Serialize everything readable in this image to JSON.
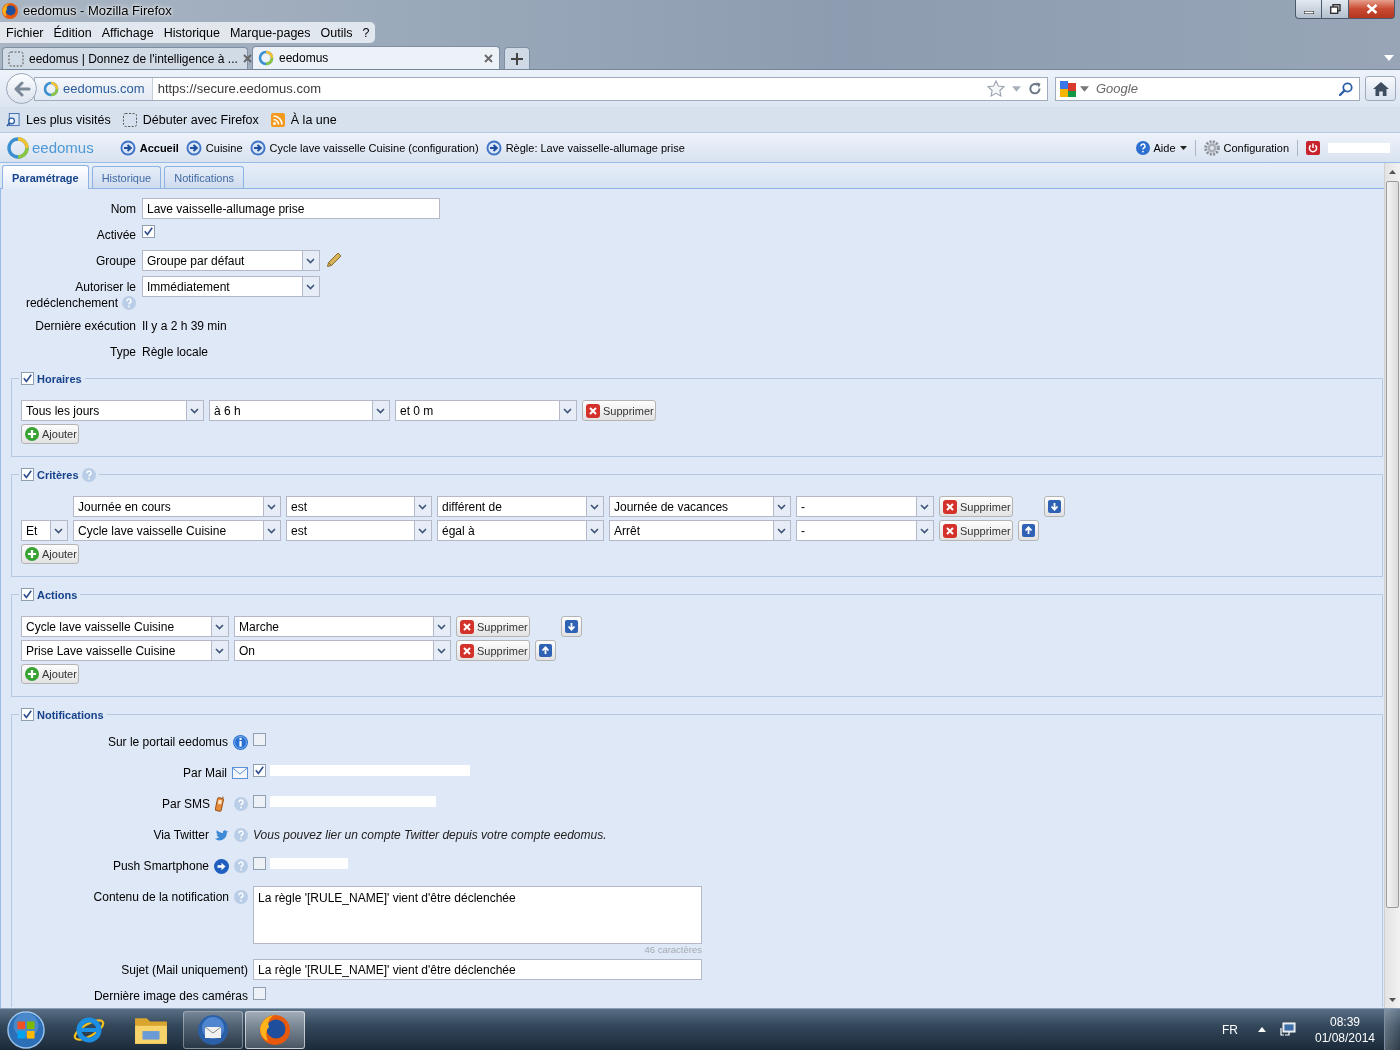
{
  "window": {
    "title": "eedomus - Mozilla Firefox"
  },
  "menu_bar": [
    "Fichier",
    "Édition",
    "Affichage",
    "Historique",
    "Marque-pages",
    "Outils",
    "?"
  ],
  "browser_tabs": [
    {
      "label": "eedomus | Donnez de l'intelligence à ...",
      "selected": false
    },
    {
      "label": "eedomus",
      "selected": true
    }
  ],
  "address_bar": {
    "site": "eedomus.com",
    "url": "https://secure.eedomus.com"
  },
  "search_bar": {
    "placeholder": "Google"
  },
  "bookmarks": [
    "Les plus visités",
    "Débuter avec Firefox",
    "À la une"
  ],
  "app_header": {
    "logo": "eedomus",
    "breadcrumb": [
      "Accueil",
      "Cuisine",
      "Cycle lave vaisselle Cuisine (configuration)",
      "Règle: Lave vaisselle-allumage prise"
    ],
    "help": "Aide",
    "settings": "Configuration"
  },
  "page_tabs": [
    {
      "label": "Paramétrage",
      "selected": true
    },
    {
      "label": "Historique",
      "selected": false
    },
    {
      "label": "Notifications",
      "selected": false
    }
  ],
  "form": [
    {
      "label": "Nom",
      "kind": "text",
      "value": "Lave vaisselle-allumage prise"
    },
    {
      "label": "Activée",
      "kind": "checkbox",
      "checked": true
    },
    {
      "label": "Groupe",
      "kind": "select",
      "value": "Groupe par défaut",
      "editable": true
    },
    {
      "label": "Autoriser le redéclenchement",
      "kind": "select",
      "value": "Immédiatement",
      "help": true
    },
    {
      "label": "Dernière exécution",
      "kind": "info",
      "value": "Il y a 2 h 39 min"
    },
    {
      "label": "Type",
      "kind": "info",
      "value": "Règle locale"
    }
  ],
  "sections": [
    {
      "title": "Horaires",
      "kind": "schedule",
      "checked": true,
      "rows": [
        {
          "selects": [
            "Tous les jours",
            "à 6 h",
            "et 0 m"
          ],
          "delete": "Supprimer"
        }
      ],
      "add": "Ajouter"
    },
    {
      "title": "Critères",
      "kind": "criteria",
      "checked": true,
      "help": true,
      "rows": [
        {
          "selects": [
            "Journée en cours",
            "est",
            "différent de",
            "Journée de vacances",
            "-"
          ],
          "delete": "Supprimer",
          "move_down": true
        },
        {
          "connector": "Et",
          "selects": [
            "Cycle lave vaisselle Cuisine",
            "est",
            "égal à",
            "Arrêt",
            "-"
          ],
          "delete": "Supprimer",
          "move_up": true
        }
      ],
      "add": "Ajouter"
    },
    {
      "title": "Actions",
      "kind": "actions",
      "checked": true,
      "rows": [
        {
          "selects": [
            "Cycle lave vaisselle Cuisine",
            "Marche"
          ],
          "delete": "Supprimer",
          "move_down": true
        },
        {
          "selects": [
            "Prise Lave vaisselle Cuisine",
            "On"
          ],
          "delete": "Supprimer",
          "move_up": true
        }
      ],
      "add": "Ajouter"
    }
  ],
  "notifications": {
    "title": "Notifications",
    "checked": true,
    "rows": [
      {
        "label": "Sur le portail eedomus",
        "kind": "checkbox",
        "checked": false
      },
      {
        "label": "Par Mail",
        "kind": "checkbox",
        "checked": true,
        "redacted": true
      },
      {
        "label": "Par SMS",
        "kind": "checkbox",
        "checked": false,
        "redacted": true,
        "help": true
      },
      {
        "label": "Via Twitter",
        "kind": "note",
        "value": "Vous pouvez lier un compte Twitter depuis votre compte eedomus.",
        "help": true
      },
      {
        "label": "Push Smartphone",
        "kind": "checkbox",
        "checked": false,
        "redacted": true,
        "help": true
      },
      {
        "label": "Contenu de la notification",
        "kind": "textarea",
        "value": "La règle '[RULE_NAME]' vient d'être déclenchée",
        "counter": "46 caractères",
        "help": true
      },
      {
        "label": "Sujet (Mail uniquement)",
        "kind": "text",
        "value": "La règle '[RULE_NAME]' vient d'être déclenchée"
      },
      {
        "label": "Dernière image des caméras",
        "kind": "checkbox",
        "checked": false
      }
    ]
  },
  "taskbar": {
    "apps": [
      {
        "running": false,
        "selected": false
      },
      {
        "running": false,
        "selected": false
      },
      {
        "running": true,
        "selected": false
      },
      {
        "running": true,
        "selected": true
      }
    ],
    "language": "FR",
    "time": "08:39",
    "date": "01/08/2014"
  }
}
